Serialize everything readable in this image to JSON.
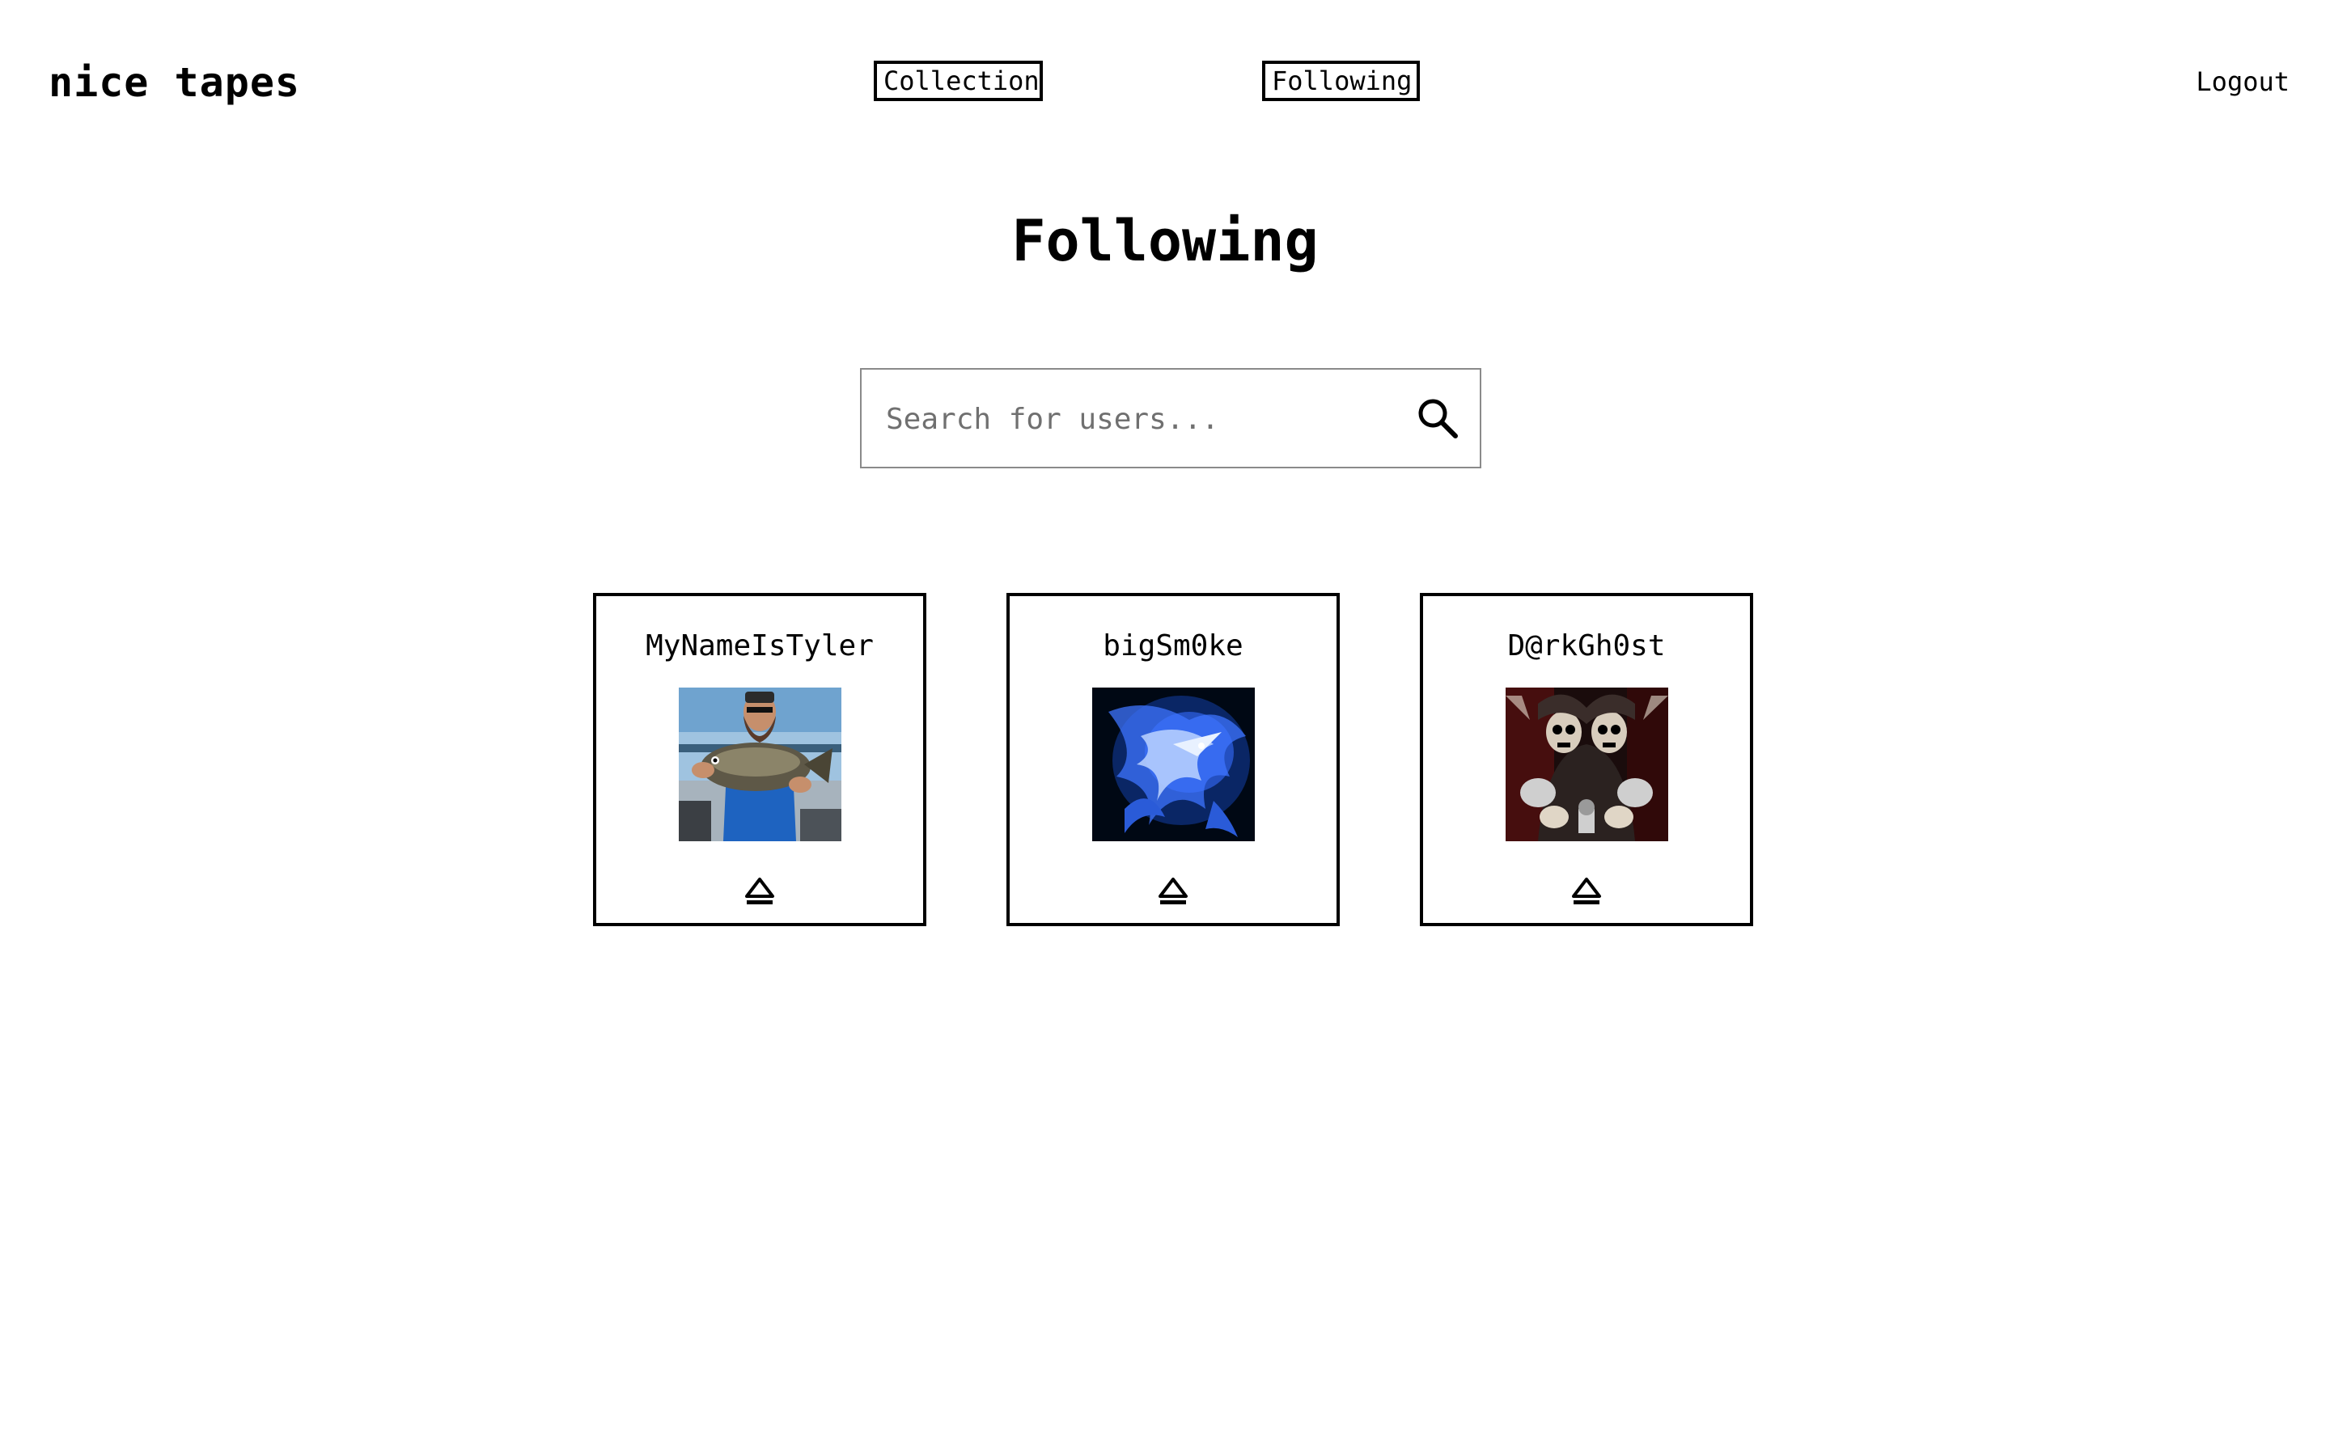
{
  "header": {
    "brand": "nice tapes",
    "nav": {
      "collection_label": "Collection",
      "following_label": "Following"
    },
    "logout_label": "Logout"
  },
  "page": {
    "title": "Following"
  },
  "search": {
    "placeholder": "Search for users...",
    "value": "",
    "icon": "search-icon"
  },
  "following": [
    {
      "username": "MyNameIsTyler",
      "avatar": "photo of man holding fish on boat",
      "action_icon": "eject-icon"
    },
    {
      "username": "bigSm0ke",
      "avatar": "blue dragon artwork",
      "action_icon": "eject-icon"
    },
    {
      "username": "D@rkGh0st",
      "avatar": "skeleton with guns artwork",
      "action_icon": "eject-icon"
    }
  ],
  "colors": {
    "background": "#ffffff",
    "text": "#000000",
    "border": "#000000",
    "search_border": "#8a8a8a",
    "placeholder": "#707070"
  }
}
